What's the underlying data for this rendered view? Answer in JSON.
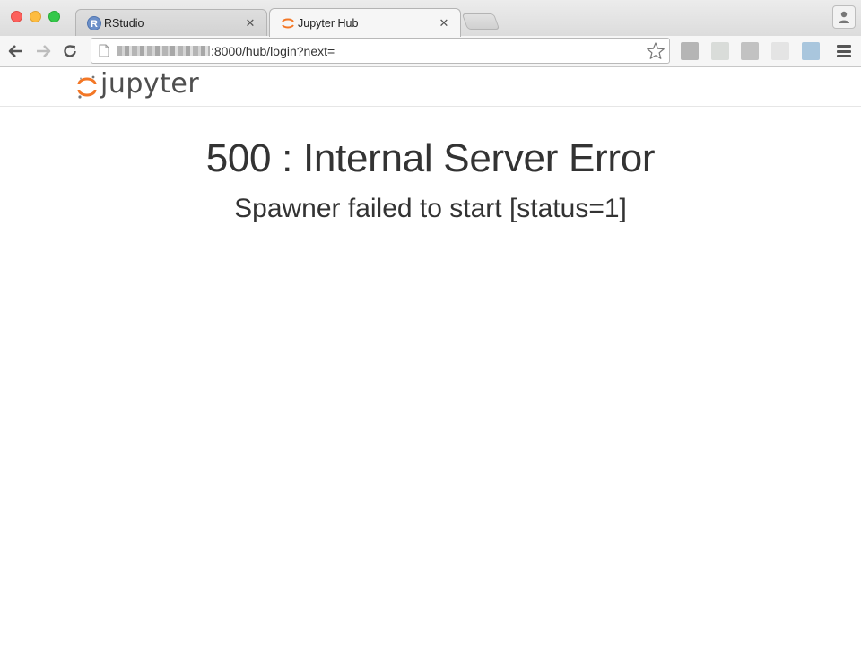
{
  "browser": {
    "tabs": [
      {
        "title": "RStudio",
        "icon": "rstudio-icon",
        "active": false
      },
      {
        "title": "Jupyter Hub",
        "icon": "jupyter-icon",
        "active": true
      }
    ],
    "address_bar": {
      "url_visible": ":8000/hub/login?next="
    }
  },
  "header": {
    "logo_text": "jupyter"
  },
  "error": {
    "title": "500 : Internal Server Error",
    "message": "Spawner failed to start [status=1]"
  },
  "colors": {
    "jupyter_orange": "#f37726",
    "text": "#333333"
  }
}
